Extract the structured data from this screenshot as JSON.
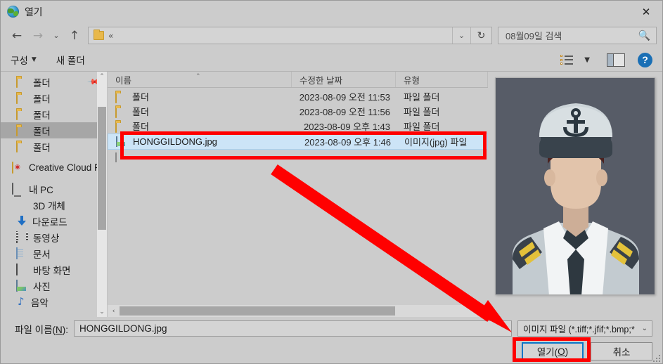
{
  "window": {
    "title": "열기",
    "app_icon": "globe-folder-icon",
    "close_label": "✕"
  },
  "nav": {
    "back": "←",
    "forward": "→",
    "recent": "⌄",
    "up": "↑",
    "address_overflow": "«",
    "address_dropdown": "⌄",
    "refresh": "↻"
  },
  "search": {
    "value": "08월09일 검색",
    "icon": "search-icon"
  },
  "toolbar": {
    "organize_label": "구성",
    "organize_caret": "▼",
    "new_folder_label": "새 폴더",
    "view_caret": "▼",
    "help_label": "?"
  },
  "sidebar": {
    "items": [
      {
        "label": "폴더",
        "icon": "folder-icon",
        "indent": true,
        "selected": false,
        "pinned": true
      },
      {
        "label": "폴더",
        "icon": "folder-icon",
        "indent": true,
        "selected": false,
        "pinned": false
      },
      {
        "label": "폴더",
        "icon": "folder-icon",
        "indent": true,
        "selected": false,
        "pinned": false
      },
      {
        "label": "폴더",
        "icon": "folder-icon",
        "indent": true,
        "selected": true,
        "pinned": false
      },
      {
        "label": "폴더",
        "icon": "folder-icon",
        "indent": true,
        "selected": false,
        "pinned": false
      },
      {
        "label": "Creative Cloud Fil",
        "icon": "creative-cloud-icon",
        "indent": false,
        "selected": false,
        "pinned": false
      },
      {
        "label": "내 PC",
        "icon": "this-pc-icon",
        "indent": false,
        "selected": false,
        "pinned": false
      },
      {
        "label": "3D 개체",
        "icon": "3d-objects-icon",
        "indent": true,
        "selected": false,
        "pinned": false
      },
      {
        "label": "다운로드",
        "icon": "downloads-icon",
        "indent": true,
        "selected": false,
        "pinned": false
      },
      {
        "label": "동영상",
        "icon": "videos-icon",
        "indent": true,
        "selected": false,
        "pinned": false
      },
      {
        "label": "문서",
        "icon": "documents-icon",
        "indent": true,
        "selected": false,
        "pinned": false
      },
      {
        "label": "바탕 화면",
        "icon": "desktop-icon",
        "indent": true,
        "selected": false,
        "pinned": false
      },
      {
        "label": "사진",
        "icon": "pictures-icon",
        "indent": true,
        "selected": false,
        "pinned": false
      },
      {
        "label": "음악",
        "icon": "music-icon",
        "indent": true,
        "selected": false,
        "pinned": false
      }
    ],
    "scroll_up": "⌃",
    "scroll_down": "⌄"
  },
  "filelist": {
    "columns": {
      "name": "이름",
      "date": "수정한 날짜",
      "type": "유형"
    },
    "sort_arrow": "⌃",
    "rows": [
      {
        "name": "폴더",
        "icon": "folder-icon",
        "date": "2023-08-09 오전 11:53",
        "type": "파일 폴더",
        "selected": false
      },
      {
        "name": "폴더",
        "icon": "folder-icon",
        "date": "2023-08-09 오전 11:56",
        "type": "파일 폴더",
        "selected": false
      },
      {
        "name": "폴더",
        "icon": "folder-icon",
        "date": "2023-08-09 오후 1:43",
        "type": "파일 폴더",
        "selected": false
      },
      {
        "name": "HONGGILDONG.jpg",
        "icon": "image-file-icon",
        "date": "2023-08-09 오후 1:46",
        "type": "이미지(jpg) 파일",
        "selected": true
      },
      {
        "name": "",
        "icon": "generic-file-icon",
        "date": "",
        "type": "",
        "selected": false
      }
    ],
    "hscroll_left": "‹",
    "hscroll_right": "›"
  },
  "preview": {
    "alt": "naval-captain-portrait"
  },
  "footer": {
    "filename_label_pre": "파일 이름(",
    "filename_label_key": "N",
    "filename_label_post": "):",
    "filename_value": "HONGGILDONG.jpg",
    "filetype_value": "이미지 파일 (*.tiff;*.jfif;*.bmp;*",
    "filetype_caret": "⌄",
    "open_label_pre": "열기(",
    "open_label_key": "O",
    "open_label_post": ")",
    "cancel_label": "취소"
  },
  "annotations": {
    "highlight_color": "#ff0000",
    "focus_color": "#0a76c8",
    "selection_color": "#cce4f7",
    "boxes": [
      "selected-file-row",
      "open-button"
    ],
    "arrow": "points from selected file to open button"
  }
}
